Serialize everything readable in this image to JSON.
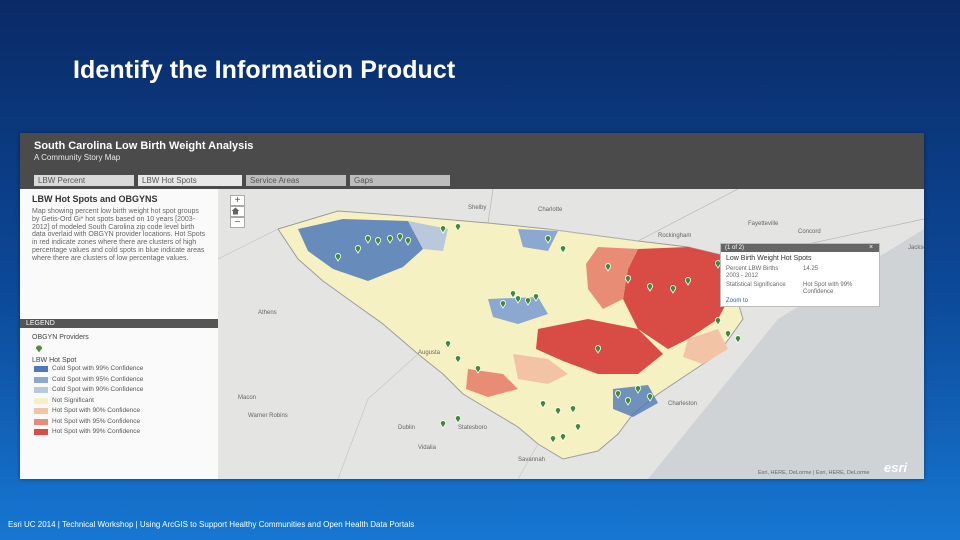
{
  "slide": {
    "title": "Identify the Information Product",
    "footer": "Esri UC 2014 | Technical Workshop | Using ArcGIS to Support Healthy Communities and Open Health Data Portals"
  },
  "app": {
    "title": "South Carolina Low Birth Weight Analysis",
    "subtitle": "A Community Story Map",
    "tabs": [
      "LBW Percent",
      "LBW Hot Spots",
      "Service Areas",
      "Gaps"
    ]
  },
  "sidebar": {
    "heading": "LBW Hot Spots and OBGYNS",
    "description": "Map showing percent low birth weight hot spot groups by Getis-Ord Gi* hot spots based on 10 years [2003-2012] of modeled South Carolina zip code level birth data overlaid with OBGYN provider locations. Hot Spots in red indicate zones where there are clusters of high percentage values and cold spots in blue indicate areas where there are clusters of low percentage values."
  },
  "legend": {
    "title": "LEGEND",
    "providers_label": "OBGYN Providers",
    "hotspot_label": "LBW Hot Spot",
    "items": [
      {
        "label": "Cold Spot with 99% Confidence",
        "color": "#4e79b8"
      },
      {
        "label": "Cold Spot with 95% Confidence",
        "color": "#8aa8d0"
      },
      {
        "label": "Cold Spot with 90% Confidence",
        "color": "#b9c8da"
      },
      {
        "label": "Not Significant",
        "color": "#f6f1c2"
      },
      {
        "label": "Hot Spot with 90% Confidence",
        "color": "#f3c3a6"
      },
      {
        "label": "Hot Spot with 95% Confidence",
        "color": "#e98c75"
      },
      {
        "label": "Hot Spot with 99% Confidence",
        "color": "#d84c45"
      }
    ]
  },
  "map": {
    "cities": [
      "Shelby",
      "Charlotte",
      "Rockingham",
      "Fayetteville",
      "Concord",
      "Jacksonville",
      "Athens",
      "Augusta",
      "Macon",
      "Warner Robins",
      "Savannah",
      "Charleston",
      "Dublin",
      "Vidalia",
      "Statesboro"
    ],
    "zoom_in": "+",
    "zoom_out": "−",
    "popup": {
      "counter": "(1 of 2)",
      "close": "×",
      "title": "Low Birth Weight Hot Spots",
      "field1": "Percent LBW Births",
      "value1": "14.25",
      "years": "2003 - 2012",
      "field2": "Statistical Significance",
      "value2": "Hot Spot with 99% Confidence",
      "zoom_link": "Zoom to"
    },
    "attribution": "Esri, HERE, DeLorme | Esri, HERE, DeLorme",
    "logo": "esri"
  }
}
